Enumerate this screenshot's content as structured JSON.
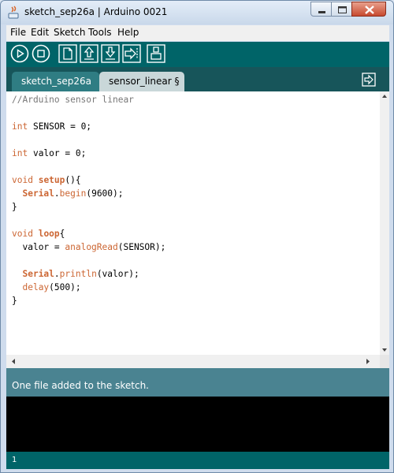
{
  "window": {
    "title": "sketch_sep26a | Arduino 0021"
  },
  "menu": [
    "File",
    "Edit",
    "Sketch",
    "Tools",
    "Help"
  ],
  "toolbar": [
    "play-icon",
    "stop-icon",
    "new-file-icon",
    "open-icon",
    "save-icon",
    "serial-monitor-icon",
    "upload-icon"
  ],
  "tabs": [
    {
      "label": "sketch_sep26a"
    },
    {
      "label": "sensor_linear §"
    }
  ],
  "code": {
    "l1": "//Arduino sensor linear",
    "l3_kw": "int",
    "l3_rest": " SENSOR = 0;",
    "l5_kw": "int",
    "l5_rest": " valor = 0;",
    "l7_kw": "void",
    "l7_fn": "setup",
    "l7_rest": "(){",
    "l8_obj": "Serial",
    "l8_dot": ".",
    "l8_fn": "begin",
    "l8_rest": "(9600);",
    "l9": "}",
    "l11_kw": "void",
    "l11_fn": "loop",
    "l11_rest": "{",
    "l12_a": "valor = ",
    "l12_fn": "analogRead",
    "l12_rest": "(SENSOR);",
    "l14_obj": "Serial",
    "l14_dot": ".",
    "l14_fn": "println",
    "l14_rest": "(valor);",
    "l15_fn": "delay",
    "l15_rest": "(500);",
    "l16": "}"
  },
  "status": {
    "message": "One file added to the sketch."
  },
  "footer": {
    "line": "1"
  },
  "colors": {
    "toolbar": "#006468",
    "status": "#4a8391",
    "keyword": "#cc6633"
  }
}
